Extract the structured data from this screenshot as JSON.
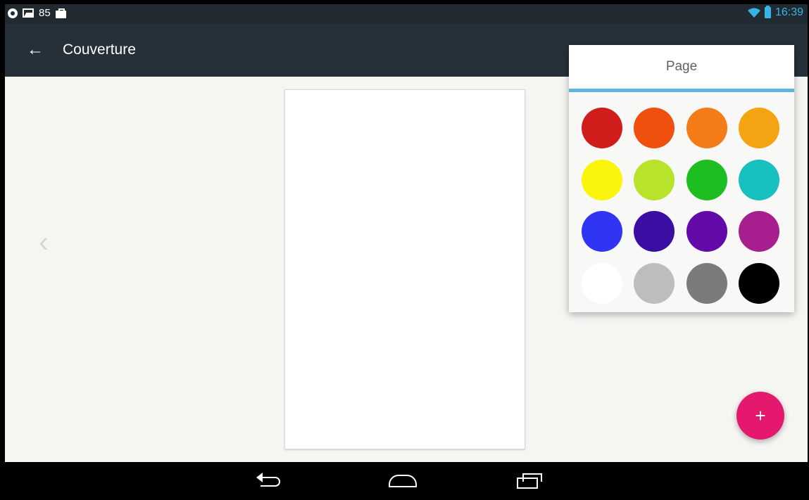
{
  "status_bar": {
    "notification_count": "85",
    "time": "16:39",
    "icons": [
      "circle-app-icon",
      "photo-icon",
      "bag-icon",
      "wifi-icon",
      "battery-icon"
    ]
  },
  "toolbar": {
    "title": "Couverture",
    "back_icon": "arrow-left-icon",
    "background_color": "#263038"
  },
  "color_popup": {
    "header": "Page",
    "indicator_color": "#5bb4e2",
    "colors": [
      "#d11c1c",
      "#ef500d",
      "#f37c18",
      "#f4a312",
      "#fbf50d",
      "#b7e32a",
      "#1ebe22",
      "#17bfbd",
      "#2f35f3",
      "#3b0ea3",
      "#6309a8",
      "#a71e8e",
      "#ffffff",
      "#bdbdbd",
      "#7b7b7b",
      "#000000"
    ]
  },
  "fab": {
    "label": "+",
    "color": "#e4196e"
  },
  "navigation": {
    "prev_icon": "chevron-left-icon",
    "nav_icons": [
      "back-icon",
      "home-icon",
      "recents-icon"
    ]
  }
}
